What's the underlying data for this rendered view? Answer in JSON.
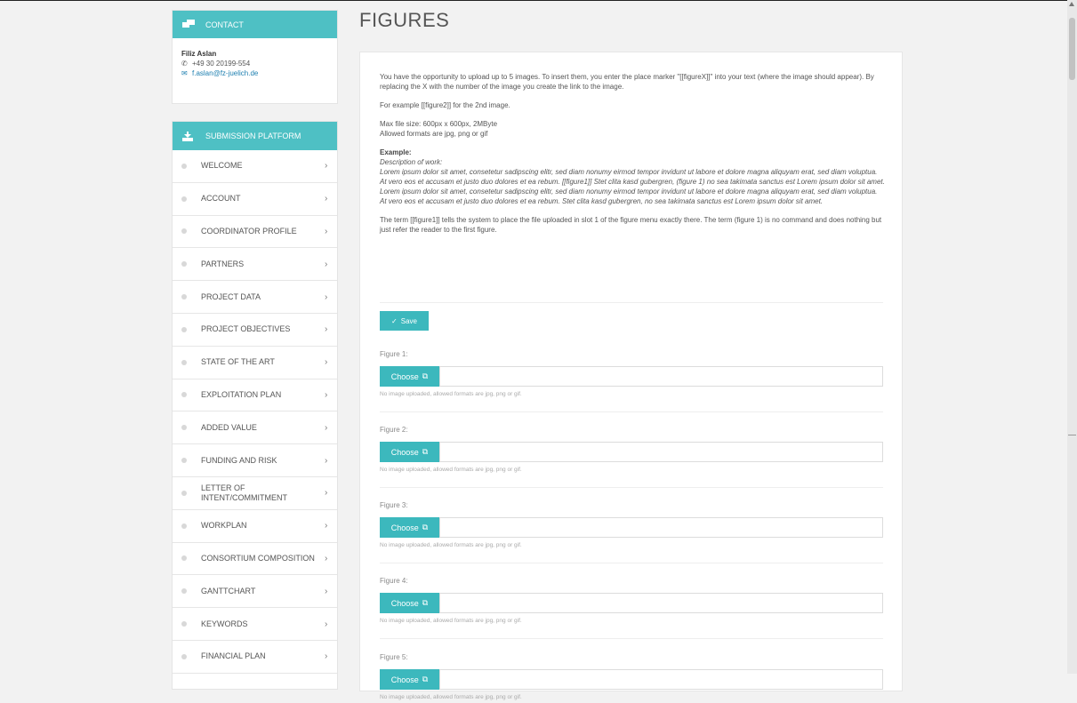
{
  "contact": {
    "header": "CONTACT",
    "name": "Filiz Aslan",
    "phone": "+49 30 20199-554",
    "email": "f.aslan@fz-juelich.de"
  },
  "platform": {
    "header": "SUBMISSION PLATFORM",
    "items": [
      {
        "label": "WELCOME"
      },
      {
        "label": "ACCOUNT"
      },
      {
        "label": "COORDINATOR PROFILE"
      },
      {
        "label": "PARTNERS"
      },
      {
        "label": "PROJECT DATA"
      },
      {
        "label": "PROJECT OBJECTIVES"
      },
      {
        "label": "STATE OF THE ART"
      },
      {
        "label": "EXPLOITATION PLAN"
      },
      {
        "label": "ADDED VALUE"
      },
      {
        "label": "FUNDING AND RISK"
      },
      {
        "label": "LETTER OF INTENT/COMMITMENT"
      },
      {
        "label": "WORKPLAN"
      },
      {
        "label": "CONSORTIUM COMPOSITION"
      },
      {
        "label": "GANTTCHART"
      },
      {
        "label": "KEYWORDS"
      },
      {
        "label": "FINANCIAL PLAN"
      }
    ]
  },
  "page": {
    "title": "FIGURES"
  },
  "intro": {
    "p1": "You have the opportunity to upload up to 5 images. To insert them, you enter the place marker \"[[figureX]]\" into your text (where the image should appear). By replacing the X with the number of the image you create the link to the image.",
    "p2": "For example [[figure2]] for the 2nd image.",
    "p3a": "Max file size: 600px x 600px, 2MByte",
    "p3b": "Allowed formats are jpg, png or gif",
    "example_title": "Example:",
    "example_sub": "Description of work:",
    "example_body": "Lorem ipsum dolor sit amet, consetetur sadipscing elitr, sed diam nonumy eirmod tempor invidunt ut labore et dolore magna aliquyam erat, sed diam voluptua. At vero eos et accusam et justo duo dolores et ea rebum. [[figure1]] Stet clita kasd gubergren, (figure 1) no sea takimata sanctus est Lorem ipsum dolor sit amet. Lorem ipsum dolor sit amet, consetetur sadipscing elitr, sed diam nonumy eirmod tempor invidunt ut labore et dolore magna aliquyam erat, sed diam voluptua. At vero eos et accusam et justo duo dolores et ea rebum. Stet clita kasd gubergren, no sea takimata sanctus est Lorem ipsum dolor sit amet.",
    "p4": "The term [[figure1]] tells the system to place the file uploaded in slot 1 of the figure menu exactly there. The term (figure 1) is no command and does nothing but just refer the reader to the first figure."
  },
  "form": {
    "save_label": "Save",
    "choose_label": "Choose",
    "hint": "No image uploaded, allowed formats are jpg, png or gif.",
    "figures": [
      {
        "label": "Figure 1:"
      },
      {
        "label": "Figure 2:"
      },
      {
        "label": "Figure 3:"
      },
      {
        "label": "Figure 4:"
      },
      {
        "label": "Figure 5:"
      }
    ]
  },
  "colors": {
    "accent": "#4ec0c4",
    "button": "#3cb8bd",
    "link": "#1d7fb0"
  }
}
